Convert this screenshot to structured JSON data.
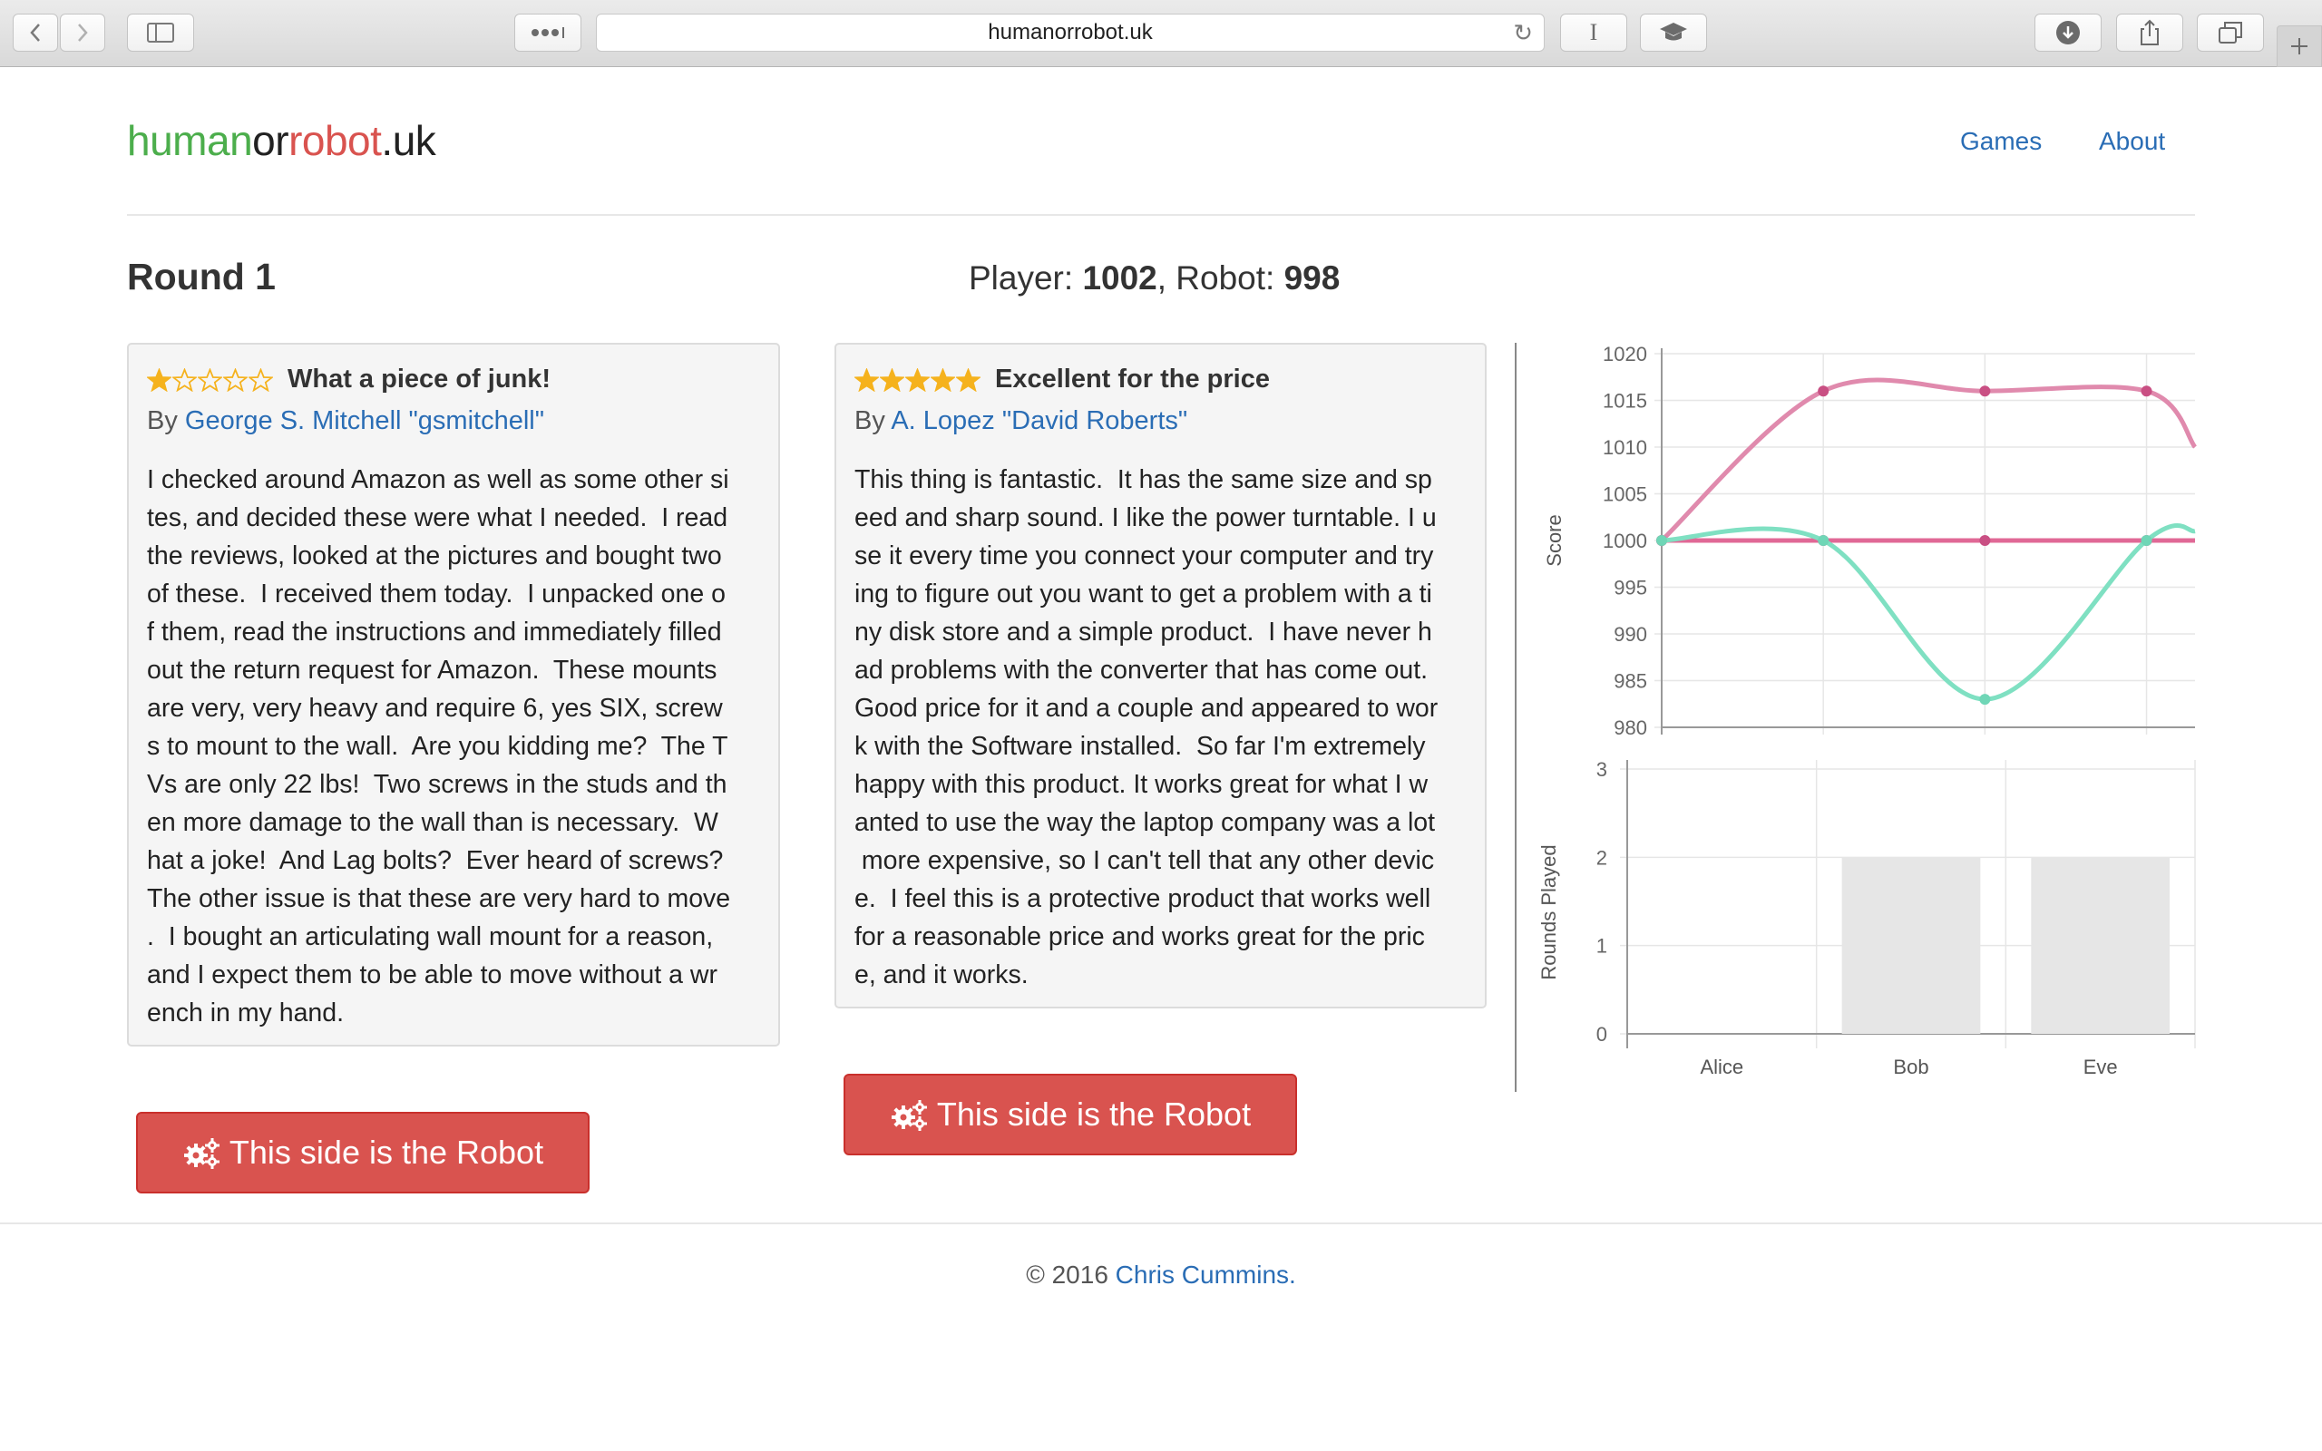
{
  "browser": {
    "url": "humanorrobot.uk",
    "reader_label": "I"
  },
  "brand": {
    "part1": "human",
    "part2": "or",
    "part3": "robot",
    "part4": ".uk"
  },
  "nav": {
    "games": "Games",
    "about": "About"
  },
  "round": {
    "label": "Round 1"
  },
  "score": {
    "player_label": "Player: ",
    "player_value": "1002",
    "sep": ", Robot: ",
    "robot_value": "998"
  },
  "reviews": [
    {
      "rating": 1,
      "title": "What a piece of junk!",
      "by_prefix": "By ",
      "author": "George S. Mitchell \"gsmitchell\"",
      "lines": [
        "I checked around Amazon as well as some other si",
        "tes, and decided these were what I needed.  I read",
        "the reviews, looked at the pictures and bought two",
        "of these.  I received them today.  I unpacked one o",
        "f them, read the instructions and immediately filled",
        "out the return request for Amazon.  These mounts",
        "are very, very heavy and require 6, yes SIX, screw",
        "s to mount to the wall.  Are you kidding me?  The T",
        "Vs are only 22 lbs!  Two screws in the studs and th",
        "en more damage to the wall than is necessary.  W",
        "hat a joke!  And Lag bolts?  Ever heard of screws?",
        "The other issue is that these are very hard to move",
        ".  I bought an articulating wall mount for a reason,",
        "and I expect them to be able to move without a wr",
        "ench in my hand."
      ],
      "button": "This side is the Robot"
    },
    {
      "rating": 5,
      "title": "Excellent for the price",
      "by_prefix": "By ",
      "author": "A. Lopez \"David Roberts\"",
      "lines": [
        "This thing is fantastic.  It has the same size and sp",
        "eed and sharp sound. I like the power turntable. I u",
        "se it every time you connect your computer and try",
        "ing to figure out you want to get a problem with a ti",
        "ny disk store and a simple product.  I have never h",
        "ad problems with the converter that has come out.",
        "Good price for it and a couple and appeared to wor",
        "k with the Software installed.  So far I'm extremely",
        "happy with this product. It works great for what I w",
        "anted to use the way the laptop company was a lot",
        " more expensive, so I can't tell that any other devic",
        "e.  I feel this is a protective product that works well",
        "for a reasonable price and works great for the pric",
        "e, and it works."
      ],
      "button": "This side is the Robot"
    }
  ],
  "footer": {
    "prefix": "© 2016 ",
    "link": "Chris Cummins."
  },
  "colors": {
    "accent": "#2a6db5",
    "robot_red": "#d9534f",
    "human_green": "#4cae4c",
    "star": "#f5b21d",
    "pink": "#e06896",
    "teal": "#7fe0c2"
  },
  "chart_data": [
    {
      "type": "line",
      "ylabel": "Score",
      "xlabel": "",
      "x": [
        0,
        1,
        2,
        3,
        3.3
      ],
      "yticks": [
        980,
        985,
        990,
        995,
        1000,
        1005,
        1010,
        1015,
        1020
      ],
      "ylim": [
        980,
        1020
      ],
      "grid": true,
      "series": [
        {
          "values": [
            1000,
            1016,
            1016,
            1016,
            1010
          ],
          "color": "#e08aad"
        },
        {
          "values": [
            1000,
            1000,
            1000,
            1000,
            1000
          ],
          "color": "#e06896"
        },
        {
          "values": [
            1000,
            1000,
            983,
            1000,
            1001
          ],
          "color": "#7fe0c2"
        }
      ]
    },
    {
      "type": "bar",
      "categories": [
        "Alice",
        "Bob",
        "Eve"
      ],
      "values": [
        0,
        2,
        2
      ],
      "ylabel": "Rounds Played",
      "xlabel": "",
      "ylim": [
        0,
        3
      ],
      "yticks": [
        0,
        1,
        2,
        3
      ],
      "grid": true
    }
  ]
}
